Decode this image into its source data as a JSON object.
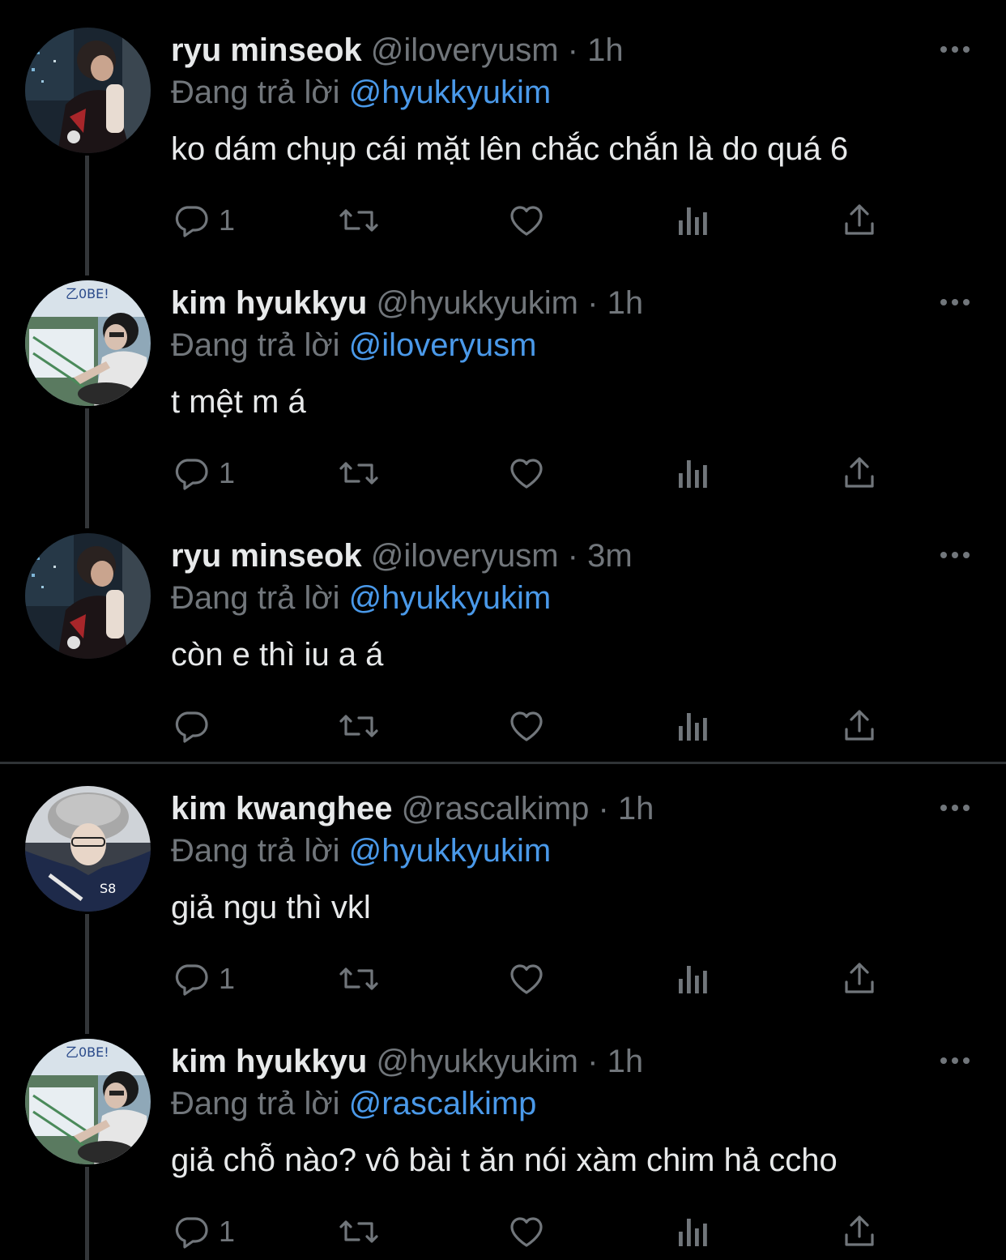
{
  "colors": {
    "background": "#000000",
    "text_primary": "#e7e9ea",
    "text_secondary": "#71767b",
    "mention": "#4a99e9",
    "thread_line": "#333639"
  },
  "tweets": [
    {
      "display_name": "ryu minseok",
      "handle": "@iloveryusm",
      "separator": "·",
      "time": "1h",
      "replying_prefix": "Đang trả lời",
      "replying_to": "@hyukkyukim",
      "text": "ko dám chụp cái mặt lên chắc chắn là do quá 6",
      "reply_count": "1",
      "avatar": "avatar-ryu"
    },
    {
      "display_name": "kim hyukkyu",
      "handle": "@hyukkyukim",
      "separator": "·",
      "time": "1h",
      "replying_prefix": "Đang trả lời",
      "replying_to": "@iloveryusm",
      "text": "t mệt m á",
      "reply_count": "1",
      "avatar": "avatar-kim"
    },
    {
      "display_name": "ryu minseok",
      "handle": "@iloveryusm",
      "separator": "·",
      "time": "3m",
      "replying_prefix": "Đang trả lời",
      "replying_to": "@hyukkyukim",
      "text": "còn e thì iu a á",
      "reply_count": "",
      "avatar": "avatar-ryu"
    },
    {
      "display_name": "kim kwanghee",
      "handle": "@rascalkimp",
      "separator": "·",
      "time": "1h",
      "replying_prefix": "Đang trả lời",
      "replying_to": "@hyukkyukim",
      "text": "giả ngu thì vkl",
      "reply_count": "1",
      "avatar": "avatar-kwanghee"
    },
    {
      "display_name": "kim hyukkyu",
      "handle": "@hyukkyukim",
      "separator": "·",
      "time": "1h",
      "replying_prefix": "Đang trả lời",
      "replying_to": "@rascalkimp",
      "text": "giả chỗ nào? vô bài t ăn nói xàm chim hả ccho",
      "reply_count": "1",
      "avatar": "avatar-kim"
    }
  ],
  "icons": {
    "more": "more-dots-icon",
    "reply": "reply-bubble-icon",
    "retweet": "retweet-icon",
    "like": "heart-icon",
    "views": "views-bars-icon",
    "share": "share-icon"
  }
}
